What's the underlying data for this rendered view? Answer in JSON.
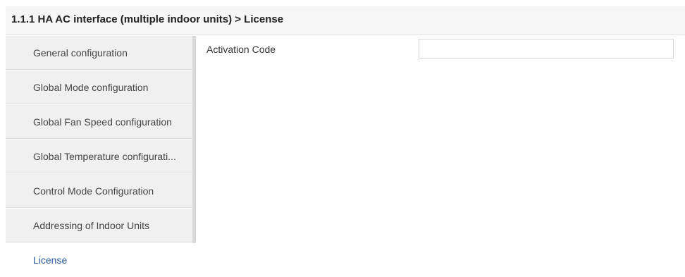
{
  "header": {
    "title": "1.1.1 HA AC interface (multiple indoor units) > License"
  },
  "sidebar": {
    "items": [
      {
        "label": "General configuration",
        "active": false
      },
      {
        "label": "Global Mode configuration",
        "active": false
      },
      {
        "label": "Global Fan Speed configuration",
        "active": false
      },
      {
        "label": "Global Temperature configurati...",
        "active": false
      },
      {
        "label": "Control Mode Configuration",
        "active": false
      },
      {
        "label": "Addressing of Indoor Units",
        "active": false
      },
      {
        "label": "License",
        "active": true
      }
    ]
  },
  "license": {
    "activation_code_label": "Activation Code",
    "activation_code_value": "",
    "activation_code_placeholder": ""
  },
  "colors": {
    "active_item_text": "#2b5797",
    "sidebar_bg": "#f0f0f0",
    "header_bg": "#f5f5f5"
  }
}
